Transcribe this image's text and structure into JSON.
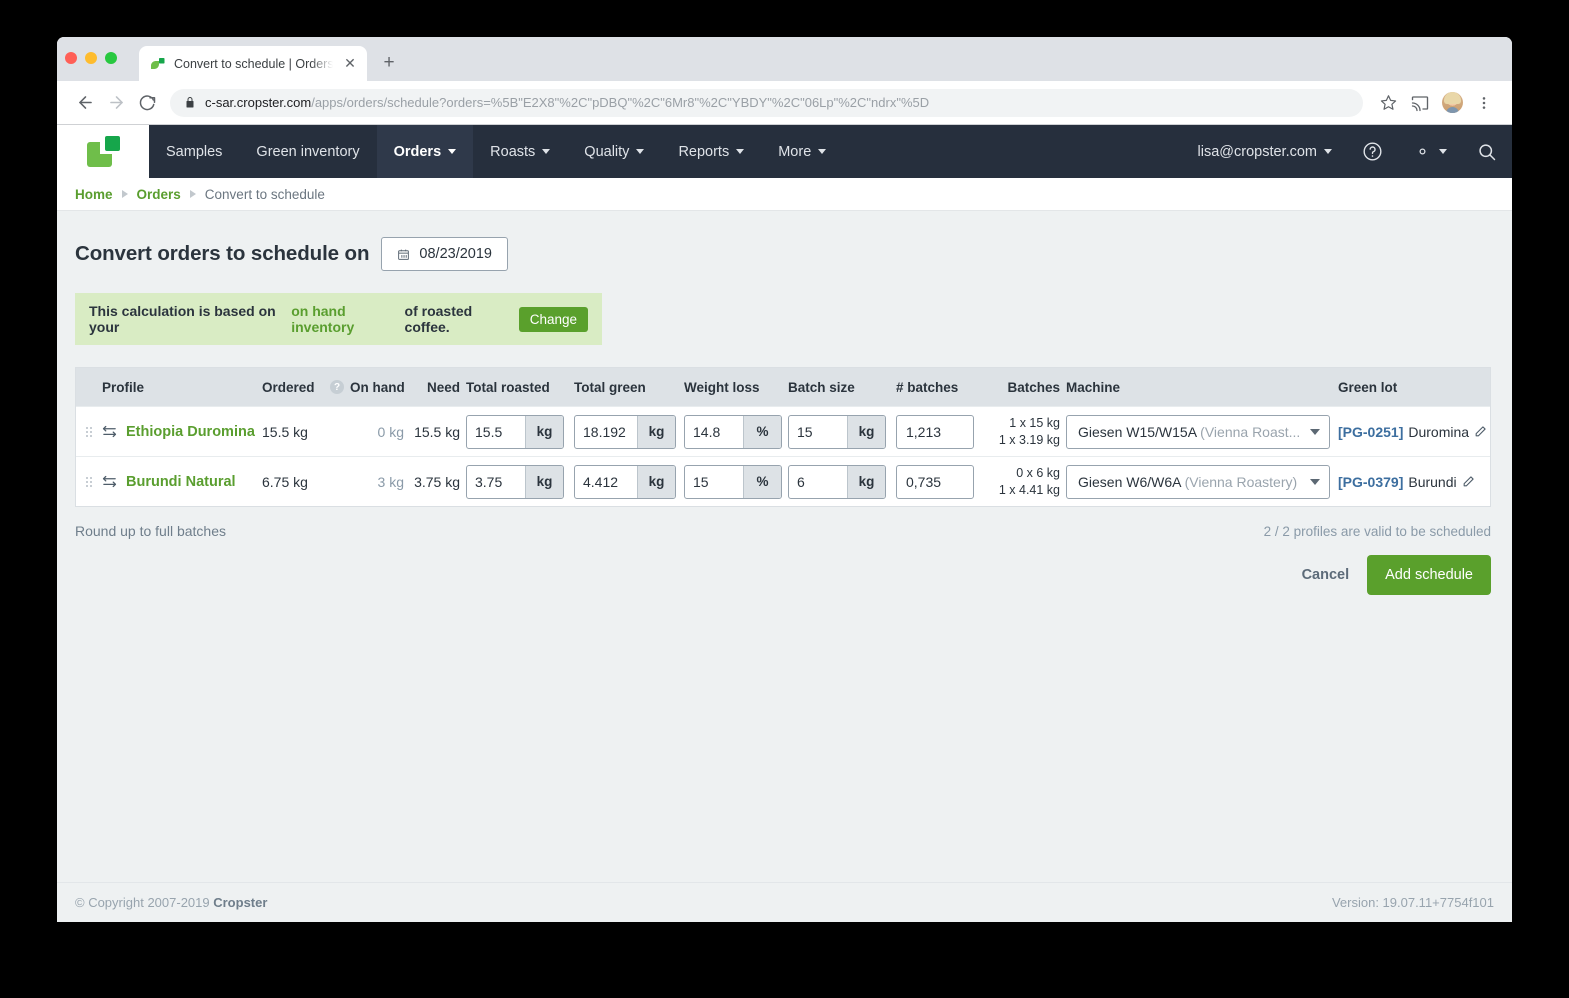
{
  "browser": {
    "tab": {
      "title": "Convert to schedule | Orders |",
      "favicon": "cropster-logo-icon",
      "close": "✕"
    },
    "newtab_label": "+",
    "url_bold": "c-sar.cropster.com",
    "url_rest": "/apps/orders/schedule?orders=%5B\"E2X8\"%2C\"pDBQ\"%2C\"6Mr8\"%2C\"YBDY\"%2C\"06Lp\"%2C\"ndrx\"%5D",
    "icons": {
      "back": "back-arrow-icon",
      "forward": "forward-arrow-icon",
      "reload": "reload-icon",
      "lock": "lock-icon",
      "bookmark": "star-icon",
      "cast": "cast-icon",
      "profile": "avatar-icon",
      "menu": "three-dot-menu-icon"
    }
  },
  "appnav": {
    "logo": "cropster-logo",
    "items": [
      {
        "label": "Samples",
        "has_caret": false,
        "active": false
      },
      {
        "label": "Green inventory",
        "has_caret": false,
        "active": false
      },
      {
        "label": "Orders",
        "has_caret": true,
        "active": true
      },
      {
        "label": "Roasts",
        "has_caret": true,
        "active": false
      },
      {
        "label": "Quality",
        "has_caret": true,
        "active": false
      },
      {
        "label": "Reports",
        "has_caret": true,
        "active": false
      },
      {
        "label": "More",
        "has_caret": true,
        "active": false
      }
    ],
    "account": "lisa@cropster.com",
    "help_icon": "help-circle-icon",
    "settings_icon": "gear-icon",
    "search_icon": "search-icon"
  },
  "breadcrumb": {
    "home": "Home",
    "orders": "Orders",
    "current": "Convert to schedule"
  },
  "page": {
    "title": "Convert orders to schedule on",
    "date": "08/23/2019",
    "calendar_icon": "calendar-icon"
  },
  "banner": {
    "text_before": "This calculation is based on your",
    "link": "on hand inventory",
    "text_after": "of roasted coffee.",
    "button": "Change",
    "bg_color": "#d9ecc4",
    "accent_color": "#5a9e2f"
  },
  "table": {
    "columns": {
      "profile": "Profile",
      "ordered": "Ordered",
      "on_hand": "On hand",
      "need": "Need",
      "total_roasted": "Total roasted",
      "total_green": "Total green",
      "weight_loss": "Weight loss",
      "batch_size": "Batch size",
      "num_batches": "# batches",
      "batches": "Batches",
      "machine": "Machine",
      "green_lot": "Green lot"
    },
    "on_hand_help_icon": "help-icon",
    "rows": [
      {
        "drag_handle_icon": "drag-handle-icon",
        "swap_icon": "swap-arrows-icon",
        "profile": "Ethiopia Duromina",
        "ordered": "15.5 kg",
        "on_hand": "0 kg",
        "need": "15.5 kg",
        "total_roasted": {
          "value": "15.5",
          "unit": "kg"
        },
        "total_green": {
          "value": "18.192",
          "unit": "kg"
        },
        "weight_loss": {
          "value": "14.8",
          "unit": "%"
        },
        "batch_size": {
          "value": "15",
          "unit": "kg"
        },
        "num_batches": "1,213",
        "batches_lines": [
          "1 x 15 kg",
          "1 x 3.19 kg"
        ],
        "machine": "Giesen W15/W15A",
        "machine_location": "(Vienna Roast...",
        "lot_id": "[PG-0251]",
        "lot_name": "Duromina",
        "edit_icon": "pencil-icon"
      },
      {
        "drag_handle_icon": "drag-handle-icon",
        "swap_icon": "swap-arrows-icon",
        "profile": "Burundi Natural",
        "ordered": "6.75 kg",
        "on_hand": "3 kg",
        "need": "3.75 kg",
        "total_roasted": {
          "value": "3.75",
          "unit": "kg"
        },
        "total_green": {
          "value": "4.412",
          "unit": "kg"
        },
        "weight_loss": {
          "value": "15",
          "unit": "%"
        },
        "batch_size": {
          "value": "6",
          "unit": "kg"
        },
        "num_batches": "0,735",
        "batches_lines": [
          "0 x 6 kg",
          "1 x 4.41 kg"
        ],
        "machine": "Giesen W6/W6A",
        "machine_location": "(Vienna Roastery)",
        "lot_id": "[PG-0379]",
        "lot_name": "Burundi",
        "edit_icon": "pencil-icon"
      }
    ]
  },
  "below": {
    "round_up": "Round up to full batches",
    "valid_text": "2 / 2 profiles are valid to be scheduled"
  },
  "actions": {
    "cancel": "Cancel",
    "add_schedule": "Add schedule",
    "primary_color": "#5aa02c"
  },
  "footer": {
    "copyright_prefix": "© Copyright 2007-2019",
    "brand": "Cropster",
    "version": "Version: 19.07.11+7754f101"
  }
}
